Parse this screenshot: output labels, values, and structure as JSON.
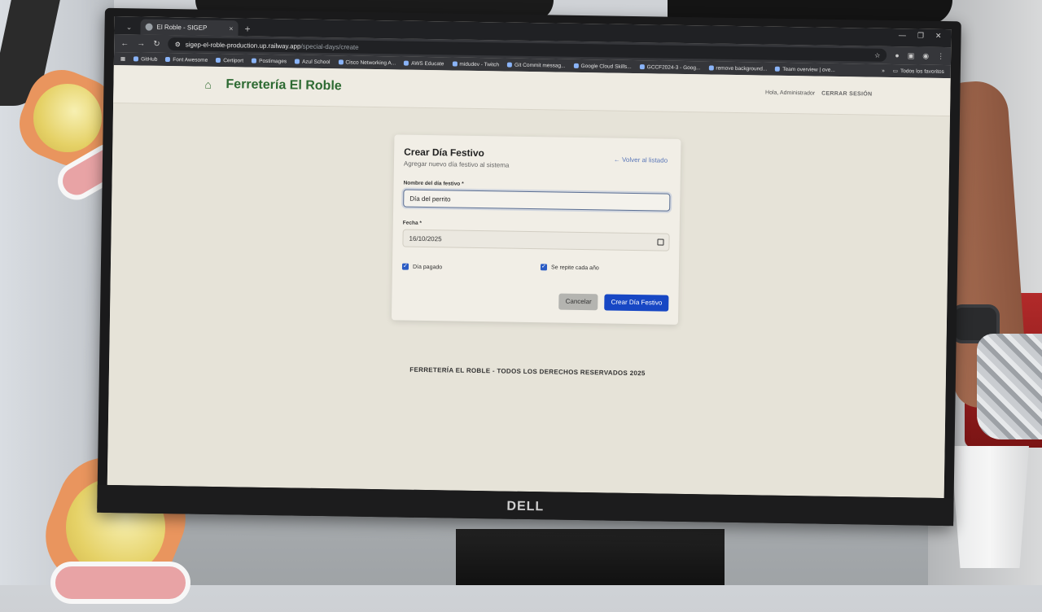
{
  "browser": {
    "tab_title": "El Roble - SIGEP",
    "tab_close": "×",
    "new_tab": "+",
    "url_host": "sigep-el-roble-production.up.railway.app",
    "url_path": "/special-days/create",
    "bookmarks": [
      "GitHub",
      "Font Awesome",
      "Certiport",
      "Postimages",
      "Azul School",
      "Cisco Networking A...",
      "AWS Educate",
      "midudev - Twitch",
      "Git Commit messag...",
      "Google Cloud Skills...",
      "GCCF2024-3 - Goog...",
      "remove background...",
      "Team overview | ove..."
    ],
    "all_bookmarks": "Todos los favoritos"
  },
  "header": {
    "brand": "Ferretería El Roble",
    "greeting": "Hola, Administrador",
    "logout": "CERRAR SESIÓN"
  },
  "form": {
    "title": "Crear Día Festivo",
    "subtitle": "Agregar nuevo día festivo al sistema",
    "back_link": "← Volver al listado",
    "name_label": "Nombre del día festivo *",
    "name_value": "Día del perrito",
    "date_label": "Fecha *",
    "date_value": "16/10/2025",
    "paid_label": "Día pagado",
    "repeat_label": "Se repite cada año",
    "cancel_label": "Cancelar",
    "create_label": "Crear Día Festivo"
  },
  "footer": {
    "text": "FERRETERÍA EL ROBLE - TODOS LOS DERECHOS RESERVADOS 2025"
  },
  "monitor": {
    "brand": "DELL"
  }
}
